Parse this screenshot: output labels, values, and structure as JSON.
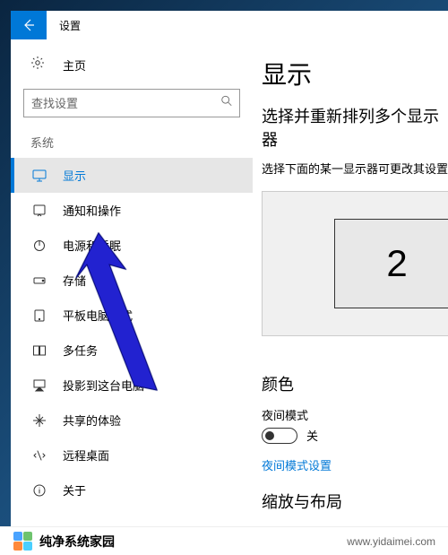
{
  "window": {
    "title": "设置"
  },
  "home": {
    "label": "主页"
  },
  "search": {
    "placeholder": "查找设置"
  },
  "section": {
    "label": "系统"
  },
  "nav": {
    "items": [
      {
        "label": "显示",
        "icon": "monitor"
      },
      {
        "label": "通知和操作",
        "icon": "notification"
      },
      {
        "label": "电源和睡眠",
        "icon": "power"
      },
      {
        "label": "存储",
        "icon": "storage"
      },
      {
        "label": "平板电脑模式",
        "icon": "tablet"
      },
      {
        "label": "多任务",
        "icon": "multitask"
      },
      {
        "label": "投影到这台电脑",
        "icon": "project"
      },
      {
        "label": "共享的体验",
        "icon": "share"
      },
      {
        "label": "远程桌面",
        "icon": "remote"
      },
      {
        "label": "关于",
        "icon": "about"
      }
    ]
  },
  "main": {
    "heading": "显示",
    "rearrange_heading": "选择并重新排列多个显示器",
    "rearrange_desc": "选择下面的某一显示器可更改其设置。某",
    "monitor_number": "2",
    "color_heading": "颜色",
    "night_mode_label": "夜间模式",
    "night_mode_state": "关",
    "night_mode_link": "夜间模式设置",
    "scale_heading": "缩放与布局"
  },
  "footer": {
    "brand": "纯净系统家园",
    "url": "www.yidaimei.com"
  }
}
